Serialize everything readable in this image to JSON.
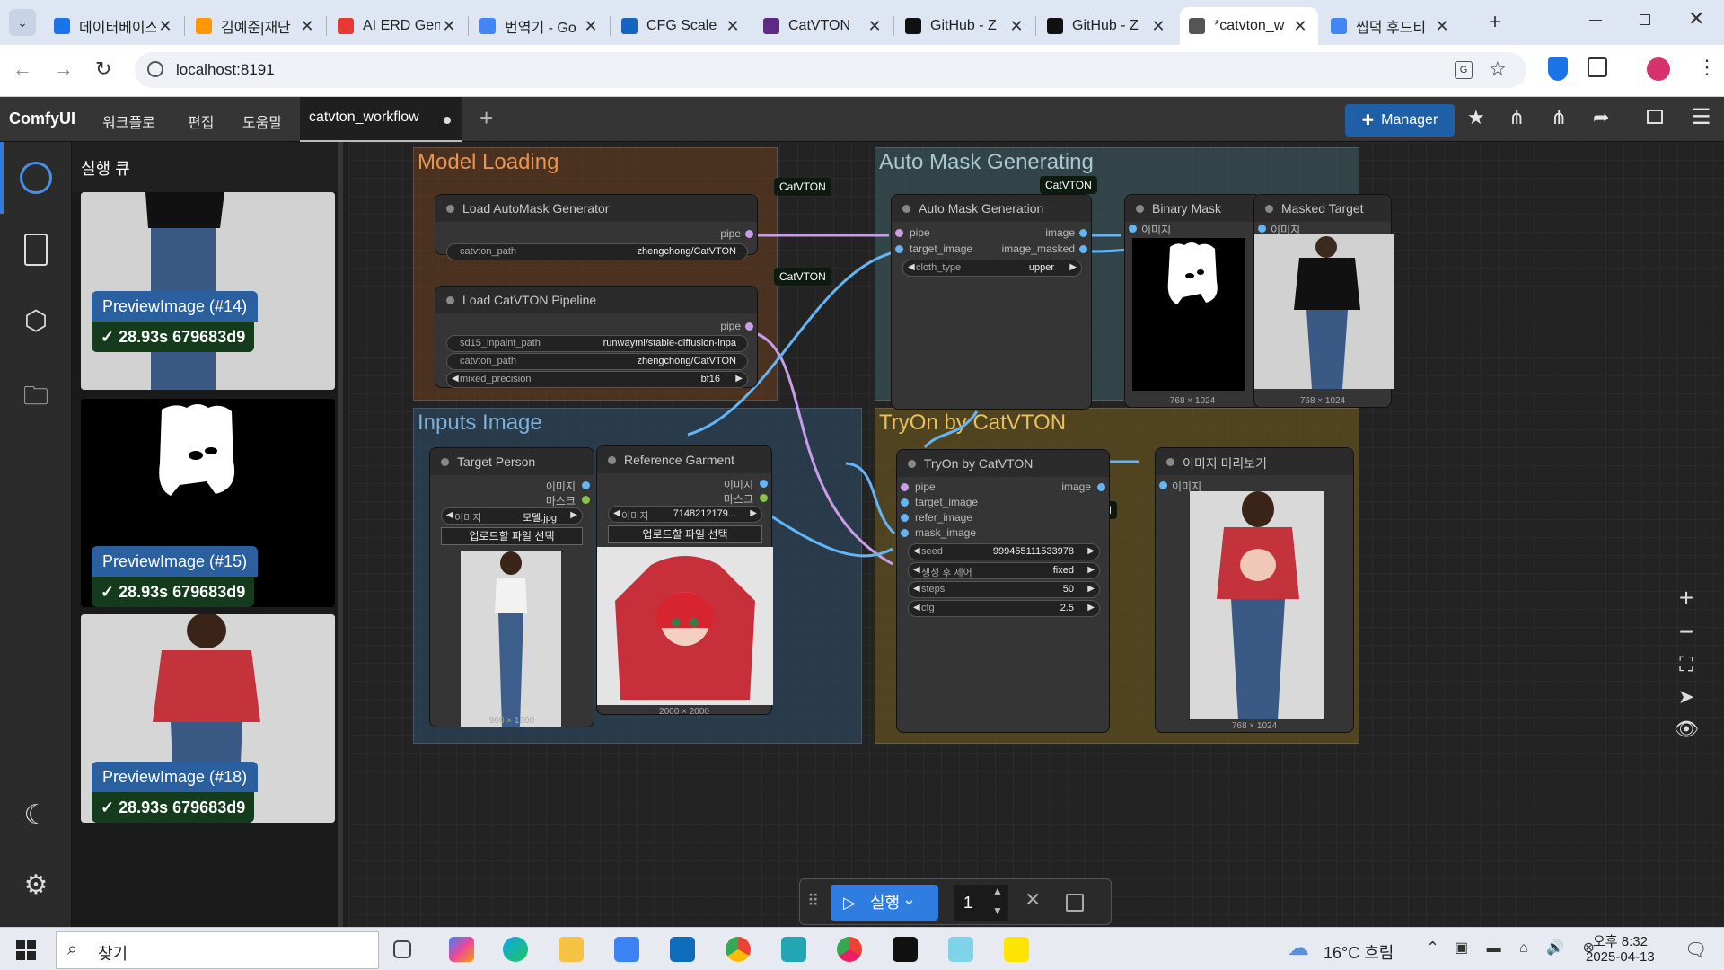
{
  "browser": {
    "tabs": [
      {
        "title": "데이터베이스",
        "color": "#1a73e8"
      },
      {
        "title": "김예준|재단",
        "color": "#ff9800"
      },
      {
        "title": "AI ERD Gen",
        "color": "#e53935"
      },
      {
        "title": "번역기 - Go",
        "color": "#4285f4"
      },
      {
        "title": "CFG Scale",
        "color": "#1565c0"
      },
      {
        "title": "CatVTON",
        "color": "#5e2a84"
      },
      {
        "title": "GitHub - Z",
        "color": "#111111"
      },
      {
        "title": "GitHub - Z",
        "color": "#111111"
      },
      {
        "title": "*catvton_w",
        "color": "#555555"
      },
      {
        "title": "씹덕 후드티",
        "color": "#4285f4"
      }
    ],
    "url": "localhost:8191"
  },
  "menu": {
    "brand": "ComfyUI",
    "items": [
      "워크플로",
      "편집",
      "도움말"
    ],
    "workflow_tab": "catvton_workflow",
    "manager_label": "Manager"
  },
  "sidebar": {
    "queue_title": "실행 큐",
    "cards": [
      {
        "label": "PreviewImage (#14)",
        "status": "✓ 28.93s 679683d9"
      },
      {
        "label": "PreviewImage (#15)",
        "status": "✓ 28.93s 679683d9"
      },
      {
        "label": "PreviewImage (#18)",
        "status": "✓ 28.93s 679683d9"
      }
    ]
  },
  "groups": {
    "model_loading": "Model Loading",
    "auto_mask": "Auto Mask Generating",
    "inputs": "Inputs Image",
    "tryon": "TryOn by CatVTON"
  },
  "badge": "CatVTON",
  "nodes": {
    "automask": {
      "title": "Load AutoMask Generator",
      "out": "pipe",
      "w_label": "catvton_path",
      "w_value": "zhengchong/CatVTON"
    },
    "pipeline": {
      "title": "Load CatVTON Pipeline",
      "out": "pipe",
      "widgets": [
        {
          "label": "sd15_inpaint_path",
          "value": "runwayml/stable-diffusion-inpa"
        },
        {
          "label": "catvton_path",
          "value": "zhengchong/CatVTON"
        },
        {
          "label": "mixed_precision",
          "value": "bf16"
        }
      ]
    },
    "maskgen": {
      "title": "Auto Mask Generation",
      "in1": "pipe",
      "in2": "target_image",
      "out1": "image",
      "out2": "image_masked",
      "w_label": "cloth_type",
      "w_value": "upper"
    },
    "binary": {
      "title": "Binary Mask",
      "in": "이미지",
      "dims": "768 × 1024"
    },
    "masked": {
      "title": "Masked Target",
      "in": "이미지",
      "dims": "768 × 1024"
    },
    "target": {
      "title": "Target Person",
      "out1": "이미지",
      "out2": "마스크",
      "w_label": "이미지",
      "w_value": "모델.jpg",
      "upload": "업로드할 파일 선택",
      "dims": "900 × 1600"
    },
    "garment": {
      "title": "Reference Garment",
      "out1": "이미지",
      "out2": "마스크",
      "w_label": "이미지",
      "w_value": "7148212179...",
      "upload": "업로드할 파일 선택",
      "dims": "2000 × 2000"
    },
    "tryon": {
      "title": "TryOn by CatVTON",
      "inputs": [
        "pipe",
        "target_image",
        "refer_image",
        "mask_image"
      ],
      "out": "image",
      "widgets": [
        {
          "label": "seed",
          "value": "999455111533978"
        },
        {
          "label": "생성 후 제어",
          "value": "fixed"
        },
        {
          "label": "steps",
          "value": "50"
        },
        {
          "label": "cfg",
          "value": "2.5"
        }
      ]
    },
    "preview": {
      "title": "이미지 미리보기",
      "in": "이미지",
      "dims": "768 × 1024"
    }
  },
  "runbar": {
    "run_label": "실행",
    "count": "1"
  },
  "taskbar": {
    "search": "찾기",
    "weather": "16°C 흐림",
    "time": "오후 8:32",
    "date": "2025-04-13"
  },
  "colors": {
    "model_group": "#5a3a2a",
    "automask_group": "#3a5357",
    "inputs_group": "#2b4456",
    "tryon_group": "#5a4a1e",
    "link_pipe": "#c99ee8",
    "link_image": "#64b5f6",
    "accent": "#2f7de1"
  }
}
